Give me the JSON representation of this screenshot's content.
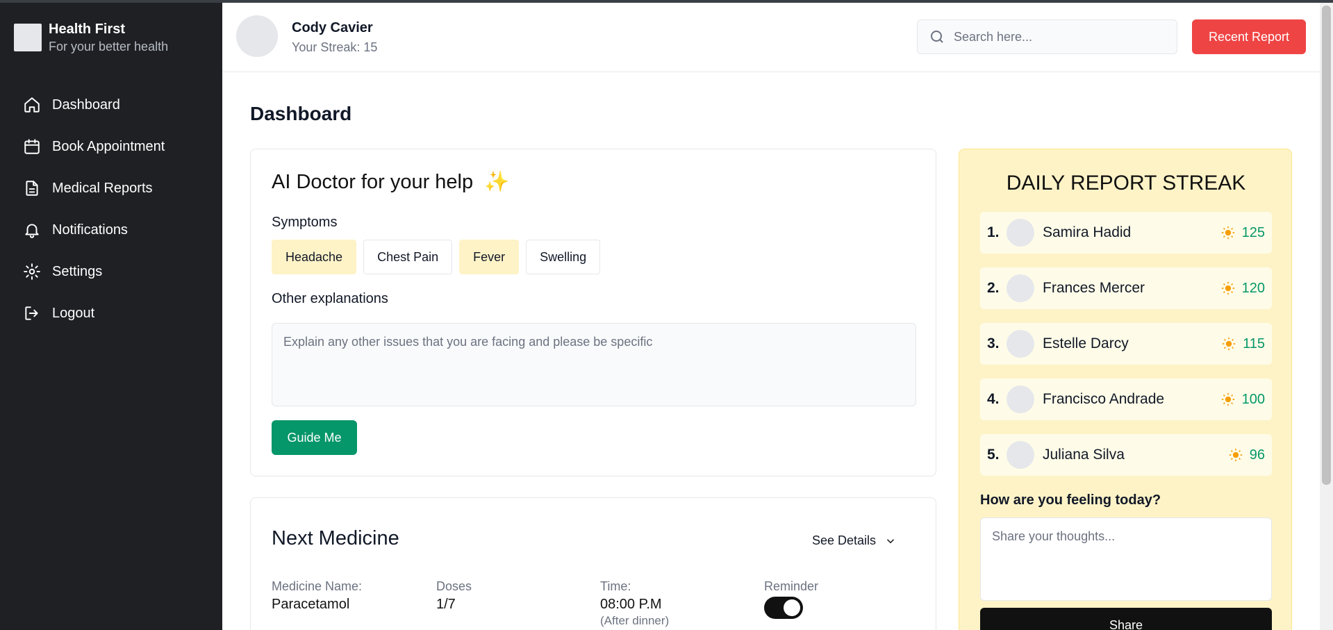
{
  "app": {
    "name": "Health First",
    "tagline": "For your better health"
  },
  "sidebar": {
    "items": [
      {
        "label": "Dashboard",
        "icon": "home-icon"
      },
      {
        "label": "Book Appointment",
        "icon": "calendar-icon"
      },
      {
        "label": "Medical Reports",
        "icon": "document-icon"
      },
      {
        "label": "Notifications",
        "icon": "bell-icon"
      },
      {
        "label": "Settings",
        "icon": "gear-icon"
      },
      {
        "label": "Logout",
        "icon": "logout-icon"
      }
    ]
  },
  "header": {
    "user_name": "Cody Cavier",
    "streak": "Your Streak: 15",
    "search_placeholder": "Search here...",
    "recent_report_label": "Recent Report"
  },
  "main": {
    "title": "Dashboard",
    "ai_card": {
      "title": "AI Doctor for your help",
      "title_emoji": "✨",
      "symptoms_label": "Symptoms",
      "symptoms": [
        {
          "label": "Headache",
          "selected": true
        },
        {
          "label": "Chest Pain",
          "selected": false
        },
        {
          "label": "Fever",
          "selected": true
        },
        {
          "label": "Swelling",
          "selected": false
        }
      ],
      "other_label": "Other explanations",
      "other_placeholder": "Explain any other issues that you are facing and please be specific",
      "guide_button": "Guide Me"
    },
    "medicine": {
      "title": "Next Medicine",
      "see_details": "See Details",
      "name_label": "Medicine Name:",
      "name_value": "Paracetamol",
      "doses_label": "Doses",
      "doses_value": "1/7",
      "time_label": "Time:",
      "time_value": "08:00 P.M",
      "time_note": "(After dinner)",
      "reminder_label": "Reminder",
      "reminder_on": true
    }
  },
  "streak": {
    "title": "DAILY REPORT STREAK",
    "entries": [
      {
        "rank": "1.",
        "name": "Samira Hadid",
        "score": "125"
      },
      {
        "rank": "2.",
        "name": "Frances Mercer",
        "score": "120"
      },
      {
        "rank": "3.",
        "name": "Estelle Darcy",
        "score": "115"
      },
      {
        "rank": "4.",
        "name": "Francisco Andrade",
        "score": "100"
      },
      {
        "rank": "5.",
        "name": "Juliana Silva",
        "score": "96"
      }
    ],
    "feeling_label": "How are you feeling today?",
    "feeling_placeholder": "Share your thoughts...",
    "share_button": "Share"
  },
  "colors": {
    "sidebar_bg": "#1e2024",
    "accent_red": "#ef4444",
    "accent_green": "#059669",
    "streak_bg": "#fef3c7",
    "chip_selected": "#fef3c7"
  }
}
